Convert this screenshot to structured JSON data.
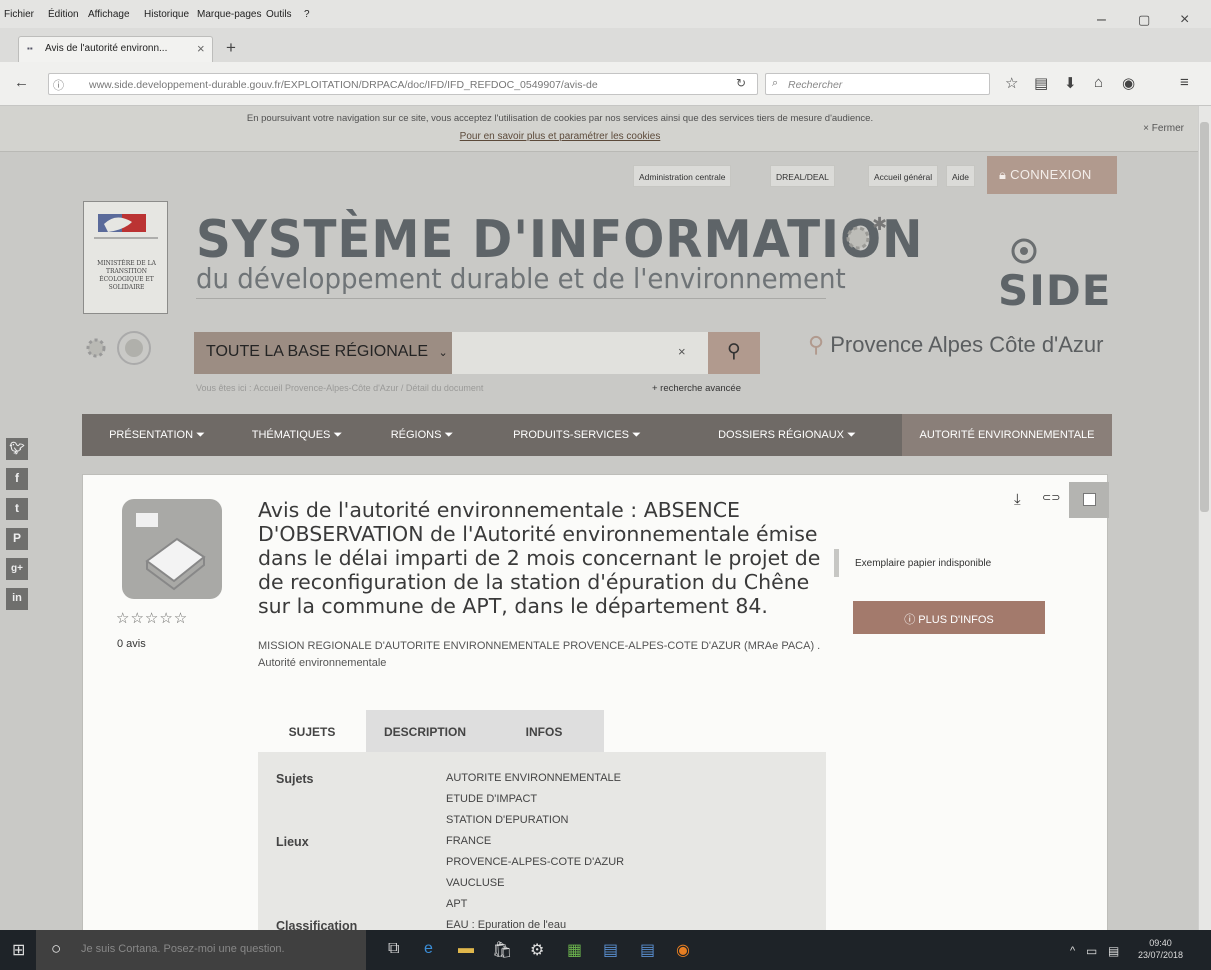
{
  "browser": {
    "menu": [
      "Fichier",
      "Édition",
      "Affichage",
      "Historique",
      "Marque-pages",
      "Outils",
      "?"
    ],
    "tab_title": "Avis de l'autorité environn...",
    "url": "www.side.developpement-durable.gouv.fr/EXPLOITATION/DRPACA/doc/IFD/IFD_REFDOC_0549907/avis-de",
    "search_placeholder": "Rechercher",
    "window_controls": [
      "minimize-icon",
      "maximize-icon",
      "close-icon"
    ]
  },
  "cookie_banner": {
    "text": "En poursuivant votre navigation sur ce site, vous acceptez l'utilisation de cookies par nos services ainsi que des services tiers de mesure d'audience.",
    "link": "Pour en savoir plus et paramétrer les cookies",
    "close": "× Fermer"
  },
  "admin_links": [
    "Administration centrale",
    "DREAL/DEAL",
    "Accueil général",
    "Aide"
  ],
  "connexion": "CONNEXION",
  "header": {
    "ministry": "MINISTÈRE DE LA TRANSITION ÉCOLOGIQUE ET SOLIDAIRE",
    "title": "SYSTÈME D'INFORMATION",
    "subtitle": "du développement durable et de l'environnement",
    "brand": "SIDE"
  },
  "search": {
    "scope": "TOUTE LA BASE RÉGIONALE",
    "clear": "×",
    "region": "Provence Alpes Côte d'Azur",
    "breadcrumb": "Vous êtes ici : Accueil Provence-Alpes-Côte d'Azur / Détail du document",
    "advanced": "+ recherche avancée"
  },
  "nav": [
    "PRÉSENTATION",
    "THÉMATIQUES",
    "RÉGIONS",
    "PRODUITS-SERVICES",
    "DOSSIERS RÉGIONAUX",
    "AUTORITÉ ENVIRONNEMENTALE"
  ],
  "social": [
    "twitter-icon",
    "facebook-icon",
    "tumblr-icon",
    "pinterest-icon",
    "google-plus-icon",
    "linkedin-icon"
  ],
  "document": {
    "rating_stars": 5,
    "reviews": "0 avis",
    "title": "Avis de l'autorité environnementale : ABSENCE D'OBSERVATION de l'Autorité environnementale émise dans le délai imparti de 2 mois concernant le projet de de reconfiguration de la station d'épuration du Chêne sur la commune de APT, dans le département 84.",
    "author": "MISSION REGIONALE D'AUTORITE ENVIRONNEMENTALE PROVENCE-ALPES-COTE D'AZUR (MRAe PACA) . Autorité environnementale",
    "availability": "Exemplaire papier indisponible",
    "more_info": "PLUS D'INFOS",
    "tabs": [
      "SUJETS",
      "DESCRIPTION",
      "INFOS"
    ],
    "fields": [
      {
        "label": "Sujets",
        "values": [
          "AUTORITE ENVIRONNEMENTALE",
          "ETUDE D'IMPACT",
          "STATION D'EPURATION"
        ]
      },
      {
        "label": "Lieux",
        "values": [
          "FRANCE",
          "PROVENCE-ALPES-COTE D'AZUR",
          "VAUCLUSE",
          "APT"
        ]
      },
      {
        "label": "Classification",
        "values": [
          "EAU : Epuration de l'eau"
        ]
      }
    ]
  },
  "taskbar": {
    "cortana": "Je suis Cortana. Posez-moi une question.",
    "time": "09:40",
    "date": "23/07/2018"
  }
}
